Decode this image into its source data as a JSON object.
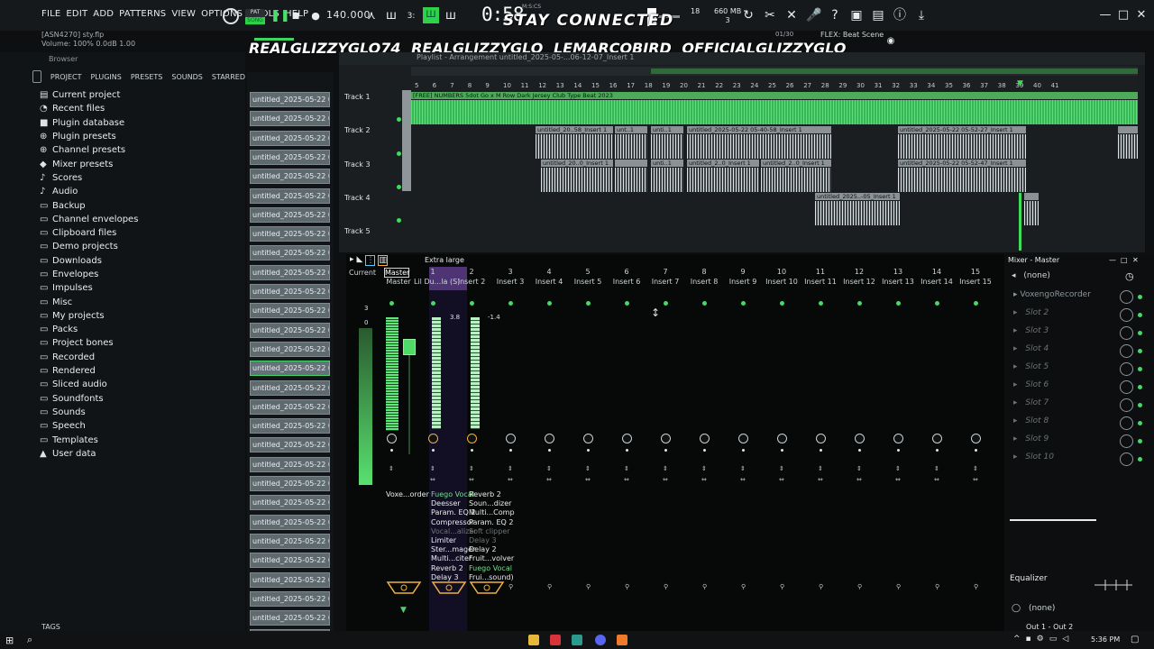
{
  "menu": [
    "FILE",
    "EDIT",
    "ADD",
    "PATTERNS",
    "VIEW",
    "OPTIONS",
    "TOOLS",
    "HELP"
  ],
  "hint": {
    "line1": "[ASN4270] sty.flp",
    "line2": "Volume: 100% 0.0dB 1.00"
  },
  "transport": {
    "song_label": "SONG",
    "pat_label": "PAT",
    "tempo": "140.000",
    "time": "0:58",
    "time_unit": "M:S:CS"
  },
  "overlay": {
    "stay_connected": "STAY CONNECTED",
    "socials": [
      "REALGLIZZYGLO74",
      "REALGLIZZYGLO",
      "LEMARCOBIRD",
      "OFFICIALGLIZZYGLO"
    ]
  },
  "stats": {
    "voices": "18",
    "cpu_mem": "660 MB",
    "cpu_line2": "3"
  },
  "flex": {
    "counter": "01/30",
    "preset": "FLEX: Beat Scene"
  },
  "browser": {
    "title": "Browser",
    "tabs": [
      "PROJECT",
      "PLUGINS",
      "PRESETS",
      "SOUNDS",
      "STARRED"
    ],
    "folders": [
      "Current project",
      "Recent files",
      "Plugin database",
      "Plugin presets",
      "Channel presets",
      "Mixer presets",
      "Scores",
      "Audio",
      "Backup",
      "Channel envelopes",
      "Clipboard files",
      "Demo projects",
      "Downloads",
      "Envelopes",
      "Impulses",
      "Misc",
      "My projects",
      "Packs",
      "Project bones",
      "Recorded",
      "Rendered",
      "Sliced audio",
      "Soundfonts",
      "Sounds",
      "Speech",
      "Templates",
      "User data"
    ],
    "tags_label": "TAGS"
  },
  "patterns": [
    "untitled_2025-05-22 06-...",
    "untitled_2025-05-22 06-...",
    "untitled_2025-05-22 06-...",
    "untitled_2025-05-22 06-...",
    "untitled_2025-05-22 06-...",
    "untitled_2025-05-22 06-...",
    "untitled_2025-05-22 06-...",
    "untitled_2025-05-22 06-...",
    "untitled_2025-05-22 06-...",
    "untitled_2025-05-22 06-...",
    "untitled_2025-05-22 06-...",
    "untitled_2025-05-22 06-...",
    "untitled_2025-05-22 06-...",
    "untitled_2025-05-22 06-...",
    "untitled_2025-05-22 06-...",
    "untitled_2025-05-22 06-...",
    "untitled_2025-05-22 06-...",
    "untitled_2025-05-22 06-...",
    "untitled_2025-05-22 06-...",
    "untitled_2025-05-22 06-...",
    "untitled_2025-05-22 06-...",
    "untitled_2025-05-22 06-...",
    "untitled_2025-05-22 06-...",
    "untitled_2025-05-22 06-...",
    "untitled_2025-05-22 06-...",
    "untitled_2025-05-22 06-...",
    "untitled_2025-05-22 06-...",
    "untitled_2025-05-22 06-...",
    "untitled_2025-05-22 06-..."
  ],
  "playlist": {
    "title": "Playlist - Arrangement  untitled_2025-05-...06-12-07_Insert 1",
    "ruler": [
      "5",
      "6",
      "7",
      "8",
      "9",
      "10",
      "11",
      "12",
      "13",
      "14",
      "15",
      "16",
      "17",
      "18",
      "19",
      "20",
      "21",
      "22",
      "23",
      "24",
      "25",
      "26",
      "27",
      "28",
      "29",
      "30",
      "31",
      "32",
      "33",
      "34",
      "35",
      "36",
      "37",
      "38",
      "39",
      "40",
      "41"
    ],
    "tracks": [
      "Track 1",
      "Track 2",
      "Track 3",
      "Track 4",
      "Track 5"
    ],
    "clips": {
      "t1": "[FREE] NUMBERS 5dot Go x M Row Dark Jersey Club Type Beat  2023",
      "t2a": "untitled_20..58_Insert 1",
      "t2b": "unt..1",
      "t2c": "unti..1",
      "t2d": "untitled_2025-05-22 05-40-58_Insert 1",
      "t2e": "untitled_2025-05-22 05-52-27_Insert 1",
      "t3a": "untitled_20..0_Insert 1",
      "t3b": "unti..1",
      "t3c": "untitled_2..0_Insert 1",
      "t3d": "untitled_2..0_Insert 1",
      "t3e": "untitled_2025-05-22 05-52-47_Insert 1",
      "t4a": "untitled_2025..-05_Insert 1"
    }
  },
  "mixer": {
    "view_label": "Extra large",
    "current_label": "Current",
    "master_label": "Master",
    "channel_numbers": [
      "1",
      "2",
      "3",
      "4",
      "5",
      "6",
      "7",
      "8",
      "9",
      "10",
      "11",
      "12",
      "13",
      "14",
      "15"
    ],
    "channel_names": [
      "Lil Du...la (S)",
      "Insert 2",
      "Insert 3",
      "Insert 4",
      "Insert 5",
      "Insert 6",
      "Insert 7",
      "Insert 8",
      "Insert 9",
      "Insert 10",
      "Insert 11",
      "Insert 12",
      "Insert 13",
      "Insert 14",
      "Insert 15"
    ],
    "levels": {
      "master_db": "0",
      "ch1": "3.8",
      "ch2": "-1.4",
      "side": "3"
    },
    "fx_master": [
      "Voxe...order"
    ],
    "fx_ch1": [
      "Fuego Vocal",
      "Deesser",
      "Param. EQ 2",
      "Compressor",
      "Vocal...alizer",
      "Limiter",
      "Ster...mager",
      "Multi...citer",
      "Reverb 2",
      "Delay 3"
    ],
    "fx_ch2": [
      "Reverb 2",
      "Soun...dizer",
      "Multi...Comp",
      "Param. EQ 2",
      "Soft clipper",
      "Delay 3",
      "Delay 2",
      "Fruit...volver",
      "Fuego Vocal",
      "Frui...sound)"
    ],
    "master_panel": {
      "title": "Mixer - Master",
      "input": "(none)",
      "slot1": "VoxengoRecorder",
      "slots": [
        "Slot 2",
        "Slot 3",
        "Slot 4",
        "Slot 5",
        "Slot 6",
        "Slot 7",
        "Slot 8",
        "Slot 9",
        "Slot 10"
      ],
      "eq_label": "Equalizer",
      "eq_input": "(none)",
      "output": "Out 1 - Out 2"
    }
  },
  "taskbar": {
    "clock": "5:36 PM"
  }
}
